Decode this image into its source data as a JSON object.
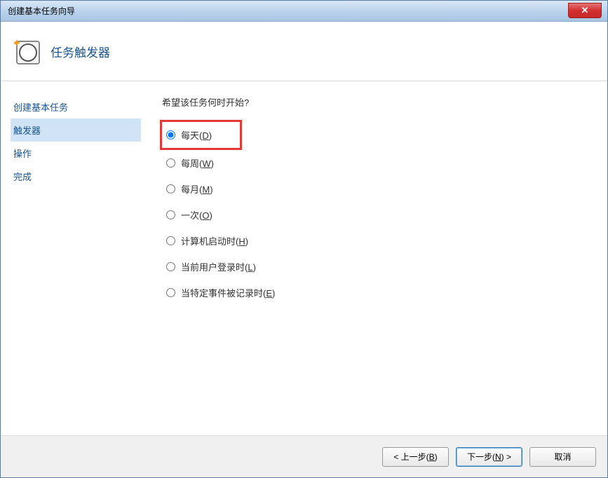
{
  "window": {
    "title": "创建基本任务向导"
  },
  "header": {
    "title": "任务触发器"
  },
  "sidebar": {
    "items": [
      {
        "label": "创建基本任务",
        "active": false
      },
      {
        "label": "触发器",
        "active": true
      },
      {
        "label": "操作",
        "active": false
      },
      {
        "label": "完成",
        "active": false
      }
    ]
  },
  "main": {
    "question": "希望该任务何时开始?",
    "options": [
      {
        "label": "每天",
        "accel": "D",
        "checked": true,
        "highlighted": true
      },
      {
        "label": "每周",
        "accel": "W",
        "checked": false,
        "highlighted": false
      },
      {
        "label": "每月",
        "accel": "M",
        "checked": false,
        "highlighted": false
      },
      {
        "label": "一次",
        "accel": "O",
        "checked": false,
        "highlighted": false
      },
      {
        "label": "计算机启动时",
        "accel": "H",
        "checked": false,
        "highlighted": false
      },
      {
        "label": "当前用户登录时",
        "accel": "L",
        "checked": false,
        "highlighted": false
      },
      {
        "label": "当特定事件被记录时",
        "accel": "E",
        "checked": false,
        "highlighted": false
      }
    ]
  },
  "footer": {
    "back_prefix": "< 上一步(",
    "back_accel": "B",
    "back_suffix": ")",
    "next_prefix": "下一步(",
    "next_accel": "N",
    "next_suffix": ") >",
    "cancel": "取消"
  }
}
